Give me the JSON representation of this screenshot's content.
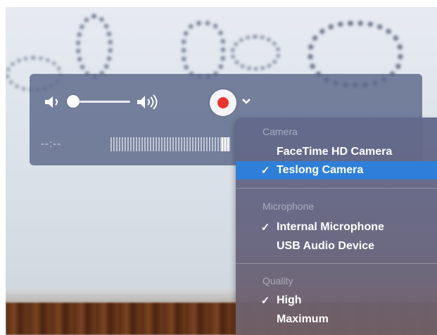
{
  "controls": {
    "time": "--:--",
    "record_button_color": "#e8352e",
    "volume_level": 0.05,
    "audio_level": 0.95
  },
  "menu": {
    "camera_header": "Camera",
    "camera_items": [
      {
        "label": "FaceTime HD Camera",
        "checked": false
      },
      {
        "label": "Teslong Camera",
        "checked": true,
        "highlighted": true
      }
    ],
    "microphone_header": "Microphone",
    "microphone_items": [
      {
        "label": "Internal Microphone",
        "checked": true
      },
      {
        "label": "USB Audio Device",
        "checked": false
      }
    ],
    "quality_header": "Quality",
    "quality_items": [
      {
        "label": "High",
        "checked": true
      },
      {
        "label": "Maximum",
        "checked": false
      }
    ],
    "check_mark": "✓",
    "highlight_color": "#2f7fd8"
  }
}
